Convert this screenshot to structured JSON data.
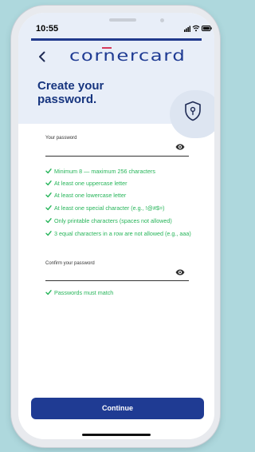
{
  "status_bar": {
    "time": "10:55",
    "icons": [
      "signal-icon",
      "wifi-icon",
      "battery-icon"
    ]
  },
  "header": {
    "back_icon": "chevron-left-icon",
    "logo_text": "cornercard",
    "title": "Create your password.",
    "badge_icon": "shield-lock-icon"
  },
  "form": {
    "password": {
      "label": "Your password",
      "value": "",
      "toggle_icon": "eye-icon"
    },
    "requirements": [
      {
        "text": "Minimum 8 — maximum 256 characters",
        "icon": "check-icon"
      },
      {
        "text": "At least one uppercase letter",
        "icon": "check-icon"
      },
      {
        "text": "At least one lowercase letter",
        "icon": "check-icon"
      },
      {
        "text": "At least one special character (e.g., !@#$=)",
        "icon": "check-icon"
      },
      {
        "text": "Only printable characters (spaces not allowed)",
        "icon": "check-icon"
      },
      {
        "text": "3 equal characters in a row are not allowed (e.g., aaa)",
        "icon": "check-icon"
      }
    ],
    "confirm": {
      "label": "Confirm your password",
      "value": "",
      "toggle_icon": "eye-icon"
    },
    "match_rule": {
      "text": "Passwords must match",
      "icon": "check-icon"
    }
  },
  "footer": {
    "continue_label": "Continue"
  },
  "colors": {
    "brand": "#1f3b93",
    "accent": "#d63b5c",
    "success": "#27b55a",
    "header_bg": "#e8eef8"
  }
}
